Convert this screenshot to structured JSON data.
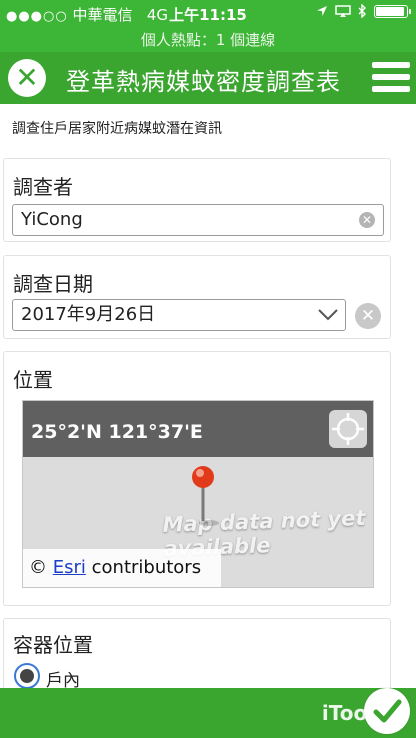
{
  "status_bar": {
    "carrier": "中華電信",
    "network": "4G",
    "time": "上午11:15",
    "hotspot": "個人熱點：1 個連線",
    "battery_level": 0.92
  },
  "header": {
    "title": "登革熱病媒蚊密度調查表"
  },
  "intro_text": "調查住戶居家附近病媒蚊潛在資訊",
  "fields": {
    "surveyor": {
      "label": "調查者",
      "value": "YiCong"
    },
    "survey_date": {
      "label": "調查日期",
      "value": "2017年9月26日"
    },
    "location": {
      "label": "位置",
      "coordinates": "25°2'N 121°37'E",
      "no_data_text": "Map data not yet available",
      "attribution_prefix": "©",
      "attribution_link": "Esri",
      "attribution_suffix": "contributors"
    },
    "container_location": {
      "label": "容器位置",
      "options": [
        "戶內"
      ]
    }
  },
  "footer": {
    "brand": "iTools"
  },
  "colors": {
    "primary_green": "#3aa52f",
    "status_green": "#3db536",
    "link_blue": "#1b3fc7",
    "radio_blue": "#3a78d6"
  }
}
